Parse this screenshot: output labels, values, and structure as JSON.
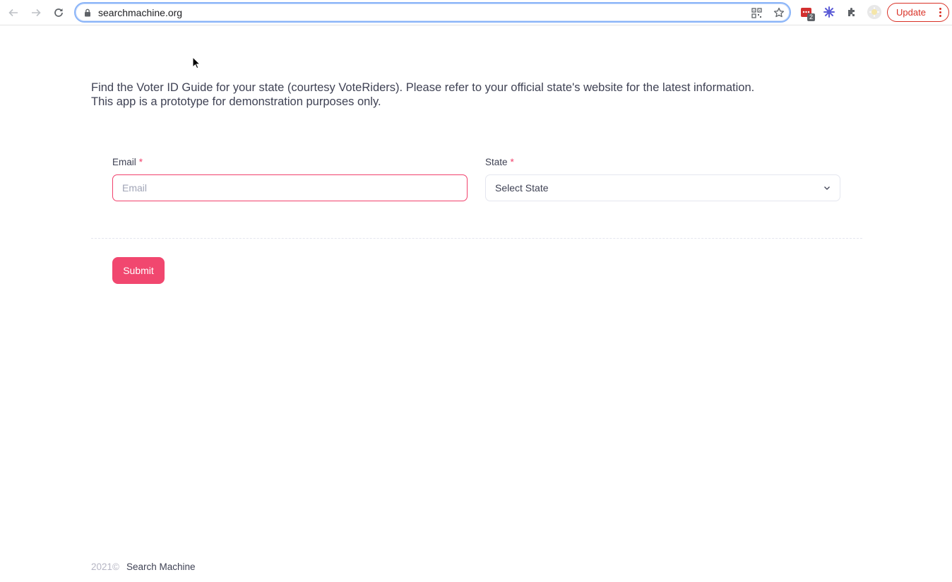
{
  "browser": {
    "url": "searchmachine.org",
    "extension_badge": "2",
    "update_label": "Update"
  },
  "page": {
    "intro_line1": "Find the Voter ID Guide for your state (courtesy VoteRiders). Please refer to your official state's website for the latest information.",
    "intro_line2": "This app is a prototype for demonstration purposes only.",
    "form": {
      "email_label": "Email",
      "email_placeholder": "Email",
      "email_value": "",
      "state_label": "State",
      "state_selected": "Select State",
      "required_marker": "*",
      "submit_label": "Submit"
    },
    "footer": {
      "year": "2021©",
      "brand": "Search Machine"
    }
  },
  "colors": {
    "accent": "#f1416c",
    "omnibox_focus": "#8ab4f8",
    "update": "#d93025"
  }
}
